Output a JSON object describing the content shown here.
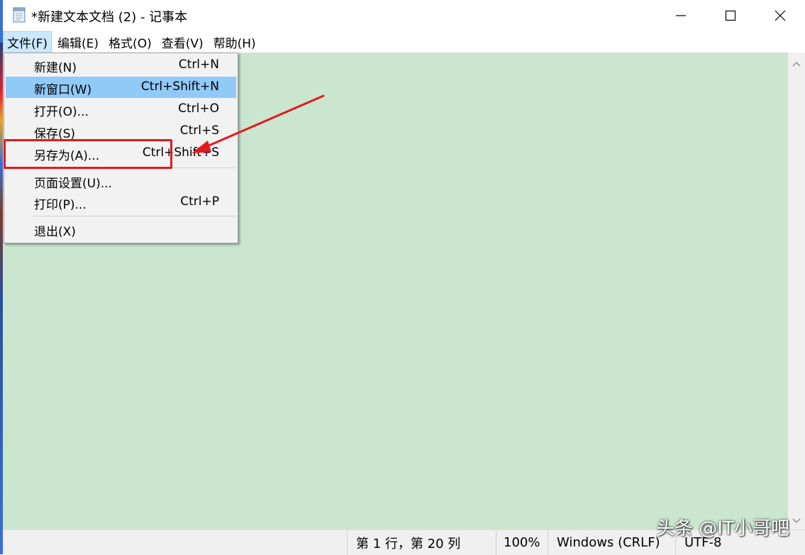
{
  "window": {
    "title": "*新建文本文档 (2) - 记事本"
  },
  "menubar": {
    "items": [
      {
        "label": "文件(F)"
      },
      {
        "label": "编辑(E)"
      },
      {
        "label": "格式(O)"
      },
      {
        "label": "查看(V)"
      },
      {
        "label": "帮助(H)"
      }
    ]
  },
  "file_menu": {
    "items": [
      {
        "label": "新建(N)",
        "shortcut": "Ctrl+N"
      },
      {
        "label": "新窗口(W)",
        "shortcut": "Ctrl+Shift+N"
      },
      {
        "label": "打开(O)...",
        "shortcut": "Ctrl+O"
      },
      {
        "label": "保存(S)",
        "shortcut": "Ctrl+S"
      },
      {
        "label": "另存为(A)...",
        "shortcut": "Ctrl+Shift+S"
      },
      {
        "label": "页面设置(U)...",
        "shortcut": ""
      },
      {
        "label": "打印(P)...",
        "shortcut": "Ctrl+P"
      },
      {
        "label": "退出(X)",
        "shortcut": ""
      }
    ],
    "highlighted": "新窗口(W)"
  },
  "statusbar": {
    "position": "第 1 行，第 20 列",
    "zoom": "100%",
    "line_ending": "Windows (CRLF)",
    "encoding": "UTF-8"
  },
  "watermark": "头条 @IT小哥吧",
  "colors": {
    "editor_background": "#cbe6cf",
    "menu_highlight": "#91c9f7",
    "annotation": "#e3191b"
  },
  "icons": {
    "app": "notepad-icon",
    "minimize": "minimize-icon",
    "maximize": "maximize-icon",
    "close": "close-icon"
  }
}
